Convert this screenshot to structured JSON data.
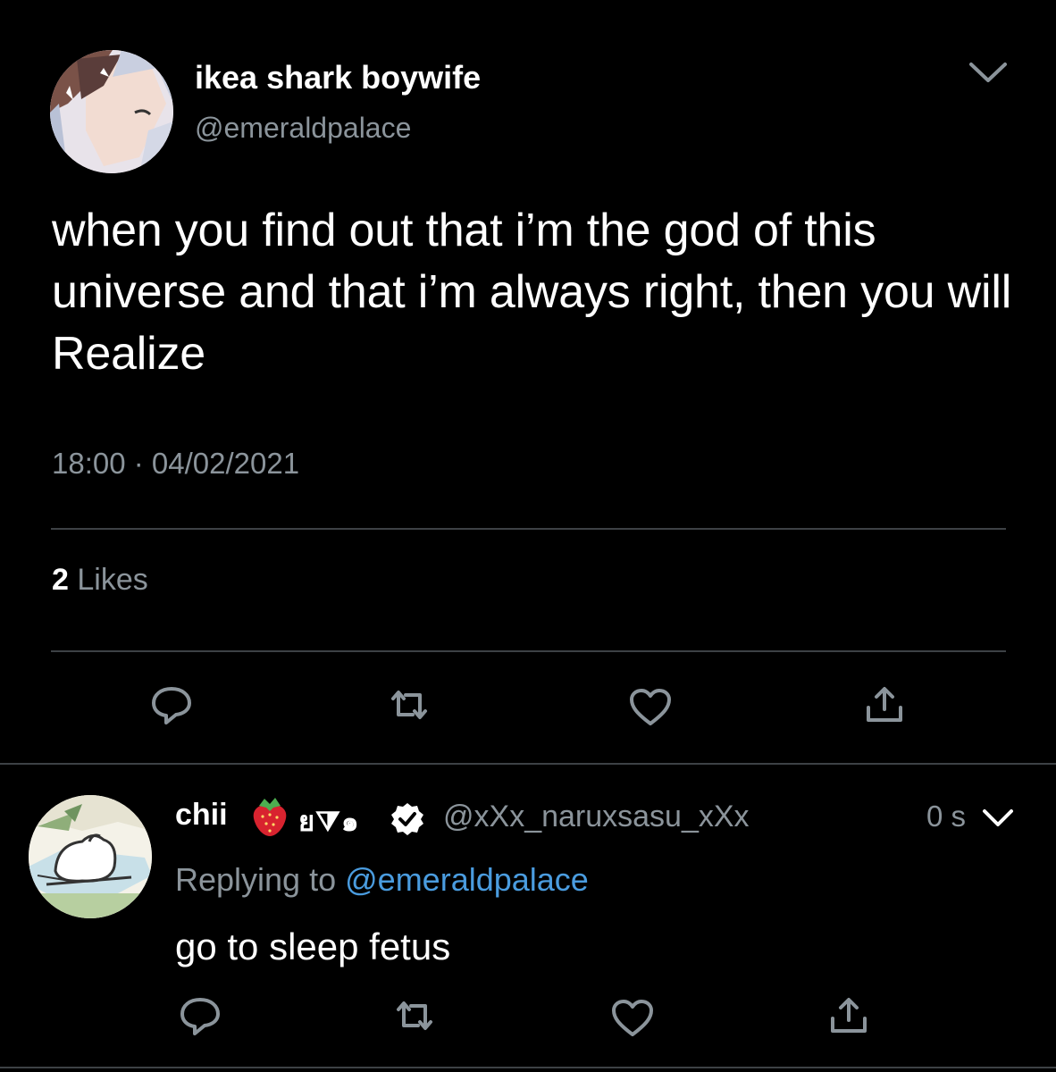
{
  "tweet": {
    "author": {
      "display_name": "ikea shark boywife",
      "handle": "@emeraldpalace",
      "avatar_icon": "anime-character-avatar"
    },
    "menu_icon": "chevron-down-icon",
    "text": "when you find out that i’m the god of this universe and that i’m always right, then you will Realize",
    "timestamp": "18:00 · 04/02/2021",
    "likes": {
      "count": "2",
      "label": "Likes"
    },
    "actions": [
      {
        "icon": "reply-icon"
      },
      {
        "icon": "retweet-icon"
      },
      {
        "icon": "like-heart-icon"
      },
      {
        "icon": "share-icon"
      }
    ]
  },
  "reply": {
    "author": {
      "display_name": "chii",
      "emoji_icon": "strawberry-icon",
      "name_suffix": "ย⧩๑",
      "verified_icon": "verified-badge-icon",
      "handle": "@xXx_naruxsasu_xXx",
      "avatar_icon": "cartoon-cat-avatar"
    },
    "time": "0 s",
    "menu_icon": "chevron-down-icon",
    "replying_label": "Replying to",
    "replying_to": "@emeraldpalace",
    "text": "go to sleep fetus",
    "actions": [
      {
        "icon": "reply-icon"
      },
      {
        "icon": "retweet-icon"
      },
      {
        "icon": "like-heart-icon"
      },
      {
        "icon": "share-icon"
      }
    ]
  },
  "colors": {
    "background": "#000000",
    "primary_text": "#ffffff",
    "secondary_text": "#8b949b",
    "link": "#4a9cdf",
    "divider": "#3d4145"
  }
}
